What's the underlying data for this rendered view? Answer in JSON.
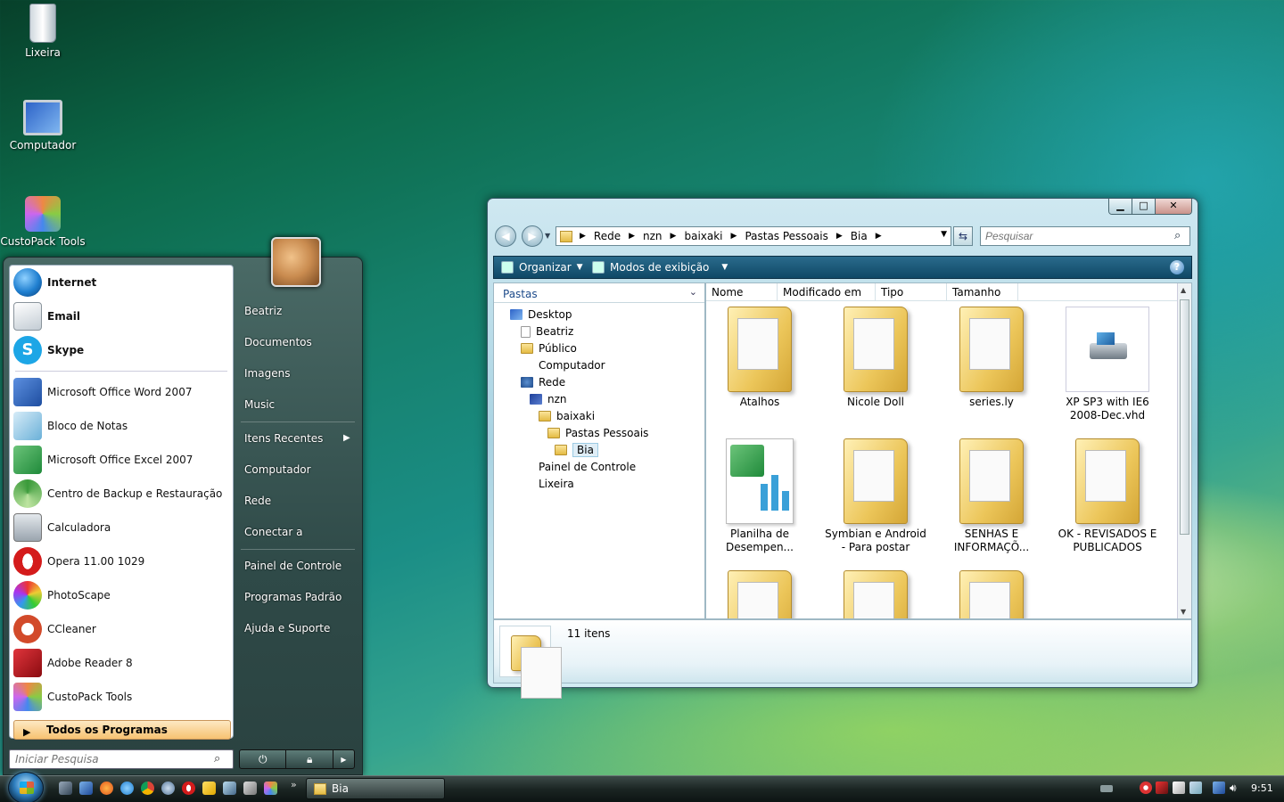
{
  "desktop": {
    "icons": [
      {
        "label": "Lixeira",
        "icon": "recycle-bin-icon"
      },
      {
        "label": "Computador",
        "icon": "computer-icon"
      },
      {
        "label": "CustoPack Tools",
        "icon": "custopack-icon"
      }
    ]
  },
  "start_menu": {
    "pinned": [
      {
        "label": "Internet",
        "icon": "globe-icon",
        "color": "#1f7fd0"
      },
      {
        "label": "Email",
        "icon": "mail-icon",
        "color": "#9aa6b0"
      },
      {
        "label": "Skype",
        "icon": "skype-icon",
        "color": "#1da6e6"
      }
    ],
    "recent": [
      {
        "label": "Microsoft Office Word 2007",
        "icon": "word-icon",
        "color": "#2b5fb4"
      },
      {
        "label": "Bloco de Notas",
        "icon": "notepad-icon",
        "color": "#6ab0d8"
      },
      {
        "label": "Microsoft Office Excel 2007",
        "icon": "excel-icon",
        "color": "#1f8a3a"
      },
      {
        "label": "Centro de Backup e Restauração",
        "icon": "backup-icon",
        "color": "#3a9a3a"
      },
      {
        "label": "Calculadora",
        "icon": "calculator-icon",
        "color": "#9aa4ae"
      },
      {
        "label": "Opera 11.00 1029",
        "icon": "opera-icon",
        "color": "#d41b1b"
      },
      {
        "label": "PhotoScape",
        "icon": "photoscape-icon",
        "color": "#555555"
      },
      {
        "label": "CCleaner",
        "icon": "ccleaner-icon",
        "color": "#d24a2a"
      },
      {
        "label": "Adobe Reader 8",
        "icon": "adobe-reader-icon",
        "color": "#b8141b"
      },
      {
        "label": "CustoPack Tools",
        "icon": "custopack-icon",
        "color": "#8a6ad0"
      }
    ],
    "all_programs": "Todos os Programas",
    "search_placeholder": "Iniciar Pesquisa",
    "right": [
      {
        "label": "Beatriz"
      },
      {
        "label": "Documentos"
      },
      {
        "label": "Imagens"
      },
      {
        "label": "Music"
      },
      {
        "label": "Itens Recentes"
      },
      {
        "label": "Computador"
      },
      {
        "label": "Rede"
      },
      {
        "label": "Conectar a"
      },
      {
        "label": "Painel de Controle"
      },
      {
        "label": "Programas Padrão"
      },
      {
        "label": "Ajuda e Suporte"
      }
    ],
    "power_icons": [
      "power-icon",
      "lock-icon",
      "arrow-right-icon"
    ]
  },
  "explorer": {
    "breadcrumbs": [
      "Rede",
      "nzn",
      "baixaki",
      "Pastas Pessoais",
      "Bia"
    ],
    "search_placeholder": "Pesquisar",
    "toolbar": {
      "organize": "Organizar",
      "views": "Modos de exibição"
    },
    "folders_header": "Pastas",
    "tree": [
      {
        "label": "Desktop",
        "icon": "desktop-icon"
      },
      {
        "label": "Beatriz",
        "icon": "user-folder-icon"
      },
      {
        "label": "Público",
        "icon": "folder-icon"
      },
      {
        "label": "Computador",
        "icon": "computer-icon"
      },
      {
        "label": "Rede",
        "icon": "network-icon"
      },
      {
        "label": "nzn",
        "icon": "network-computer-icon"
      },
      {
        "label": "baixaki",
        "icon": "folder-icon"
      },
      {
        "label": "Pastas Pessoais",
        "icon": "folder-icon"
      },
      {
        "label": "Bia",
        "icon": "folder-icon"
      },
      {
        "label": "Painel de Controle",
        "icon": "control-panel-icon"
      },
      {
        "label": "Lixeira",
        "icon": "recycle-bin-icon"
      }
    ],
    "columns": [
      "Nome",
      "Modificado em",
      "Tipo",
      "Tamanho"
    ],
    "files": [
      {
        "name": "Atalhos",
        "kind": "folder"
      },
      {
        "name": "Nicole Doll",
        "kind": "folder"
      },
      {
        "name": "series.ly",
        "kind": "folder"
      },
      {
        "name": "XP SP3 with IE6 2008-Dec.vhd",
        "kind": "vhd"
      },
      {
        "name": "Planilha de Desempen...",
        "kind": "excel"
      },
      {
        "name": "Symbian e Android - Para postar",
        "kind": "folder"
      },
      {
        "name": "SENHAS E INFORMAÇÕ...",
        "kind": "folder"
      },
      {
        "name": "OK - REVISADOS E PUBLICADOS",
        "kind": "folder"
      },
      {
        "name": "",
        "kind": "folder"
      },
      {
        "name": "",
        "kind": "folder"
      },
      {
        "name": "",
        "kind": "folder"
      }
    ],
    "item_count": "11 itens"
  },
  "taskbar": {
    "task": "Bia",
    "clock": "9:51",
    "more": "»"
  },
  "colors": {
    "accent": "#1f6f9a",
    "desktop": "#157f6a"
  }
}
